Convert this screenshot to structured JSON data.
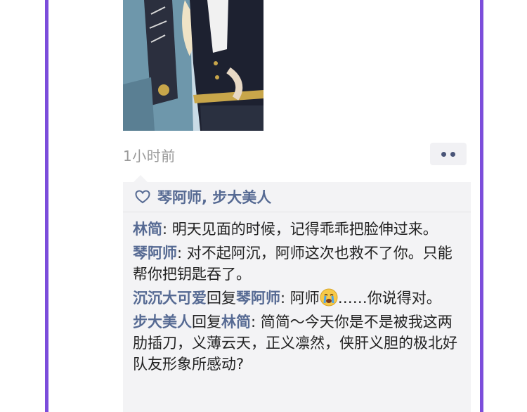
{
  "post": {
    "time": "1小时前"
  },
  "likes": {
    "names": "琴阿师, 步大美人"
  },
  "comments": [
    {
      "author": "林简",
      "sep": ": ",
      "text": "明天见面的时候，记得乖乖把脸伸过来。"
    },
    {
      "author": "琴阿师",
      "sep": ": ",
      "text": "对不起阿沉，阿师这次也救不了你。只能帮你把钥匙吞了。"
    },
    {
      "author": "沉沉大可爱",
      "reply_word": "回复",
      "reply_to": "琴阿师",
      "sep": ": ",
      "text_before": "阿师",
      "emoji": "crying-face-emoji",
      "text_after": "……你说得对。"
    },
    {
      "author": "步大美人",
      "reply_word": "回复",
      "reply_to": "林简",
      "sep": ": ",
      "text": "简简～今天你是不是被我这两肋插刀，义薄云天，正义凛然，侠肝义胆的极北好队友形象所感动?"
    }
  ],
  "colors": {
    "frame_border": "#7c4ddb",
    "name_link": "#566a93",
    "comment_bg": "#f3f3f5",
    "timestamp": "#9a9a9a"
  },
  "icons": [
    "heart-icon",
    "more-dots-icon",
    "crying-face-emoji"
  ]
}
